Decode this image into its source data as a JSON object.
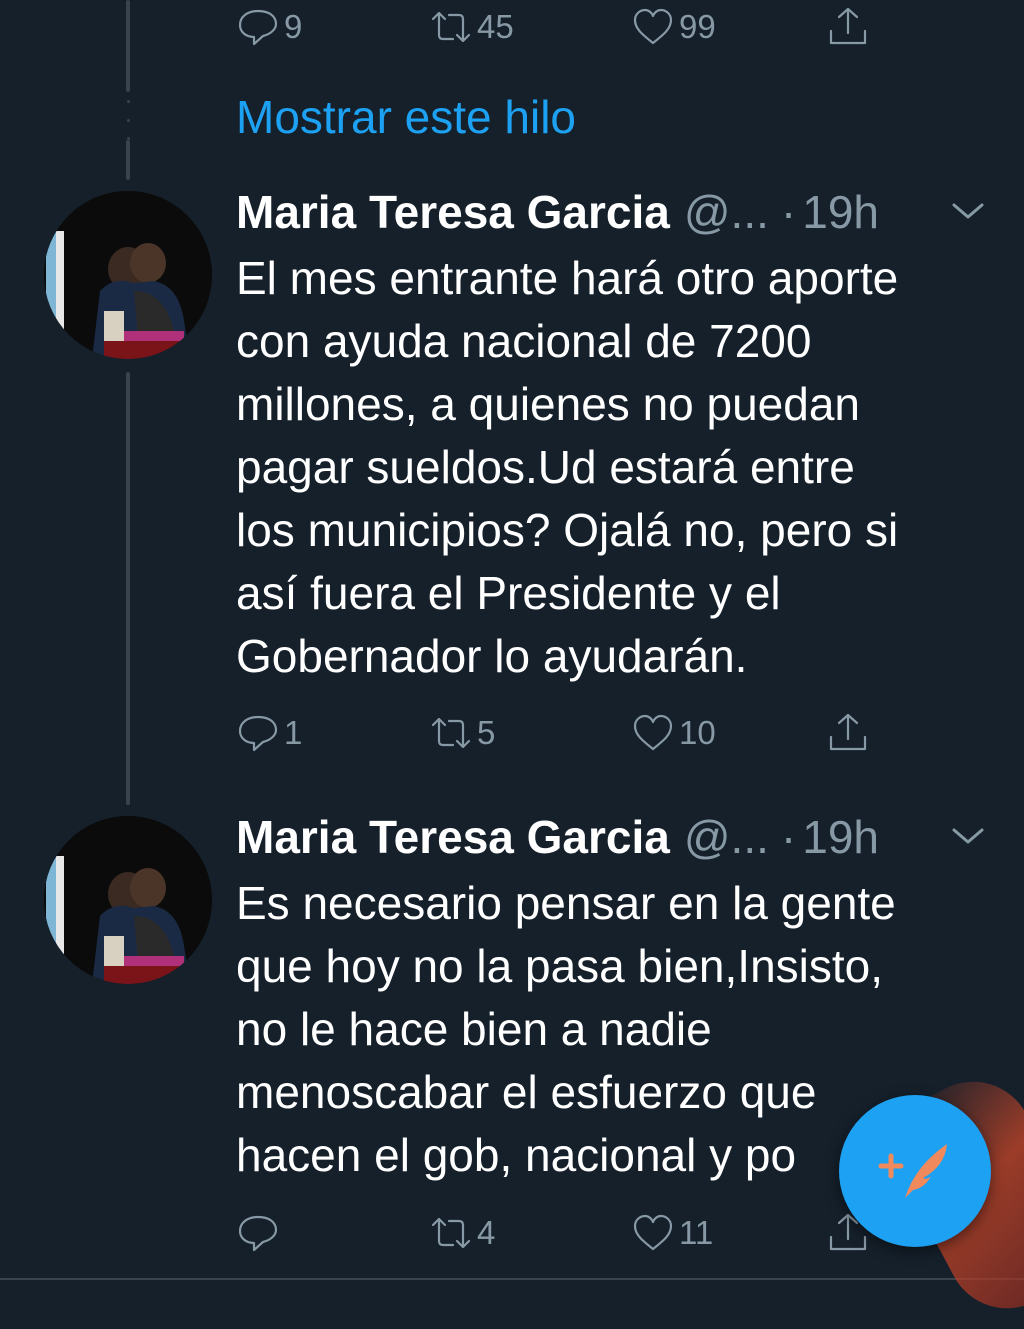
{
  "top_actions": {
    "replies": "9",
    "retweets": "45",
    "likes": "99"
  },
  "show_thread_label": "Mostrar este hilo",
  "tweets": [
    {
      "name": "Maria Teresa Garcia",
      "handle": "@...",
      "separator": "·",
      "time": "19h",
      "lines": [
        "El mes entrante hará otro aporte",
        "con ayuda nacional de 7200",
        "millones, a quienes no puedan",
        "pagar sueldos.Ud estará entre",
        "los municipios? Ojalá no, pero si",
        "así fuera el Presidente y el",
        "Gobernador lo ayudarán."
      ],
      "replies": "1",
      "retweets": "5",
      "likes": "10"
    },
    {
      "name": "Maria Teresa Garcia",
      "handle": "@...",
      "separator": "·",
      "time": "19h",
      "lines": [
        "Es necesario pensar en la gente",
        "que hoy no la pasa bien,Insisto,",
        "no le hace bien a nadie",
        "menoscabar el esfuerzo que",
        "hacen el gob, nacional y po"
      ],
      "replies": "",
      "retweets": "4",
      "likes": "11"
    }
  ],
  "icons": {
    "reply": "reply-icon",
    "retweet": "retweet-icon",
    "like": "heart-icon",
    "share": "share-icon",
    "menu": "chevron-down-icon",
    "compose": "compose-tweet-icon"
  },
  "colors": {
    "background": "#15202b",
    "accent": "#1da1f2",
    "secondary_text": "#8899a6",
    "divider": "#38444d"
  }
}
